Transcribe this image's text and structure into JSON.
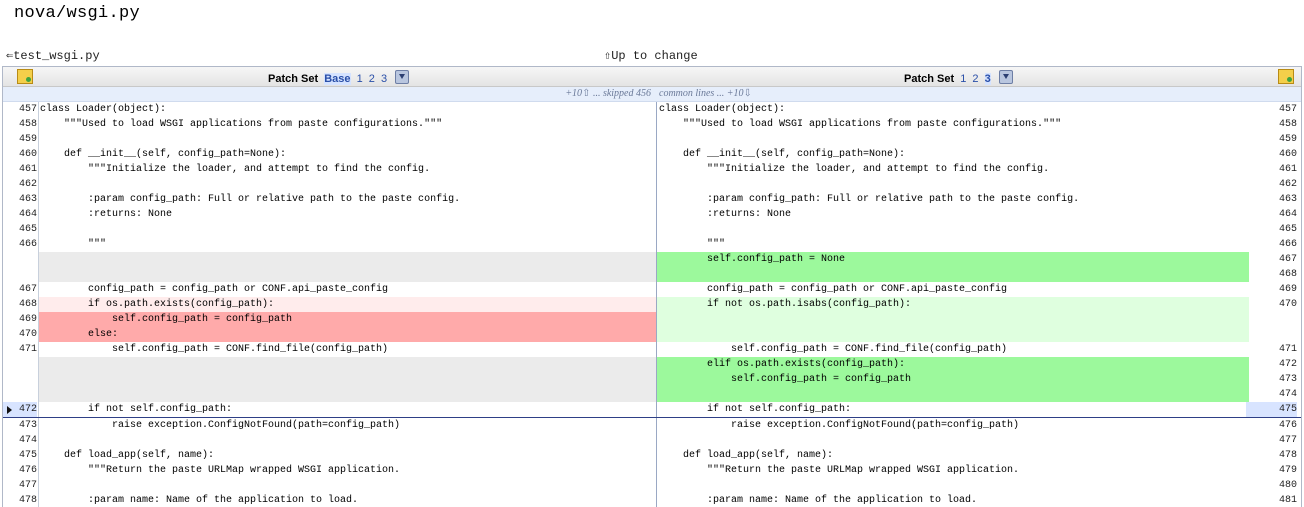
{
  "file_title": "nova/wsgi.py",
  "nav": {
    "prev_file": "⇐test_wsgi.py",
    "up_to_change": "⇧Up to change"
  },
  "header": {
    "patch_set_label": "Patch Set",
    "left_versions": [
      "Base",
      "1",
      "2",
      "3"
    ],
    "left_selected": "Base",
    "right_versions": [
      "1",
      "2",
      "3"
    ],
    "right_selected": "3"
  },
  "skip_bar": {
    "left_text": "+10⇧ ... skipped 456",
    "right_text": "common lines ... +10⇩"
  },
  "rows": [
    {
      "ln": "457",
      "code": "class Loader(object):",
      "rn": "457",
      "rcode": "class Loader(object):"
    },
    {
      "ln": "458",
      "code": "    \"\"\"Used to load WSGI applications from paste configurations.\"\"\"",
      "rn": "458",
      "rcode": "    \"\"\"Used to load WSGI applications from paste configurations.\"\"\""
    },
    {
      "ln": "459",
      "code": "",
      "rn": "459",
      "rcode": ""
    },
    {
      "ln": "460",
      "code": "    def __init__(self, config_path=None):",
      "rn": "460",
      "rcode": "    def __init__(self, config_path=None):"
    },
    {
      "ln": "461",
      "code": "        \"\"\"Initialize the loader, and attempt to find the config.",
      "rn": "461",
      "rcode": "        \"\"\"Initialize the loader, and attempt to find the config."
    },
    {
      "ln": "462",
      "code": "",
      "rn": "462",
      "rcode": ""
    },
    {
      "ln": "463",
      "code": "        :param config_path: Full or relative path to the paste config.",
      "rn": "463",
      "rcode": "        :param config_path: Full or relative path to the paste config."
    },
    {
      "ln": "464",
      "code": "        :returns: None",
      "rn": "464",
      "rcode": "        :returns: None"
    },
    {
      "ln": "465",
      "code": "",
      "rn": "465",
      "rcode": ""
    },
    {
      "ln": "466",
      "code": "        \"\"\"",
      "rn": "466",
      "rcode": "        \"\"\""
    },
    {
      "ln": "",
      "code": "",
      "rn": "467\n468",
      "rcode": "        self.config_path = None\n"
    },
    {
      "ln": "467",
      "code": "        config_path = config_path or CONF.api_paste_config",
      "rn": "469",
      "rcode": "        config_path = config_path or CONF.api_paste_config"
    },
    {
      "ln": "468",
      "code": "        if os.path.exists(config_path):",
      "rn": "470",
      "rcode": "        if not os.path.isabs(config_path):"
    },
    {
      "ln": "469\n470",
      "code": "            self.config_path = config_path\n        else:",
      "rn": "",
      "rcode": ""
    },
    {
      "ln": "471",
      "code": "            self.config_path = CONF.find_file(config_path)",
      "rn": "471",
      "rcode": "            self.config_path = CONF.find_file(config_path)"
    },
    {
      "ln": "",
      "code": "",
      "rn": "472\n473\n474",
      "rcode": "        elif os.path.exists(config_path):\n            self.config_path = config_path\n"
    },
    {
      "ln": "472",
      "code": "        if not self.config_path:",
      "rn": "475",
      "rcode": "        if not self.config_path:"
    },
    {
      "ln": "473",
      "code": "            raise exception.ConfigNotFound(path=config_path)",
      "rn": "476",
      "rcode": "            raise exception.ConfigNotFound(path=config_path)"
    },
    {
      "ln": "474",
      "code": "",
      "rn": "477",
      "rcode": ""
    },
    {
      "ln": "475",
      "code": "    def load_app(self, name):",
      "rn": "478",
      "rcode": "    def load_app(self, name):"
    },
    {
      "ln": "476",
      "code": "        \"\"\"Return the paste URLMap wrapped WSGI application.",
      "rn": "479",
      "rcode": "        \"\"\"Return the paste URLMap wrapped WSGI application."
    },
    {
      "ln": "477",
      "code": "",
      "rn": "480",
      "rcode": ""
    },
    {
      "ln": "478",
      "code": "        :param name: Name of the application to load.",
      "rn": "481",
      "rcode": "        :param name: Name of the application to load."
    }
  ]
}
